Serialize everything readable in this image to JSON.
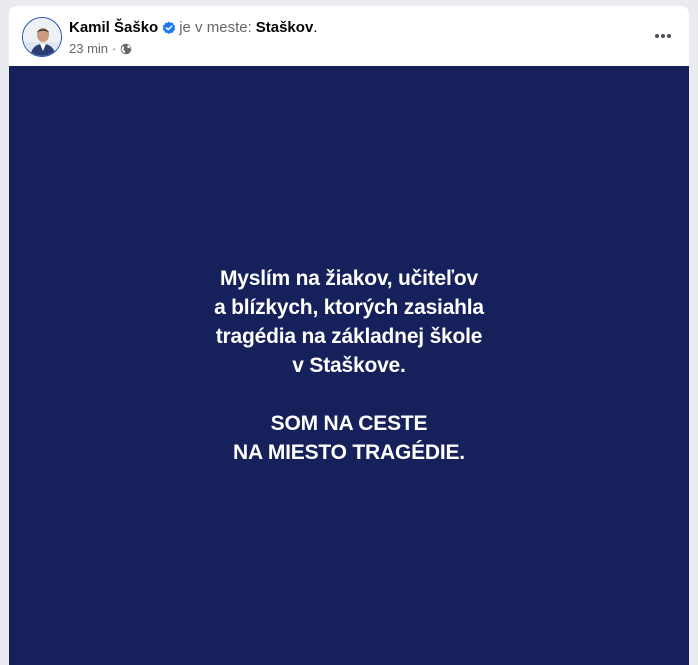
{
  "post": {
    "author": "Kamil Šaško",
    "verified_icon": "verified-badge-icon",
    "at_text": "je v meste:",
    "place": "Staškov",
    "period": ".",
    "time": "23 min",
    "separator": "·",
    "audience_icon": "globe-icon",
    "more_icon": "more-options-icon"
  },
  "image_text": {
    "paragraph1": [
      "Myslím na žiakov, učiteľov",
      "a blízkych, ktorých zasiahla",
      "tragédia na základnej škole",
      "v Staškove."
    ],
    "paragraph2": [
      "SOM NA CESTE",
      "NA MIESTO TRAGÉDIE."
    ]
  },
  "colors": {
    "background": "#16205b",
    "text": "#ffffff",
    "verified": "#1877f2"
  }
}
